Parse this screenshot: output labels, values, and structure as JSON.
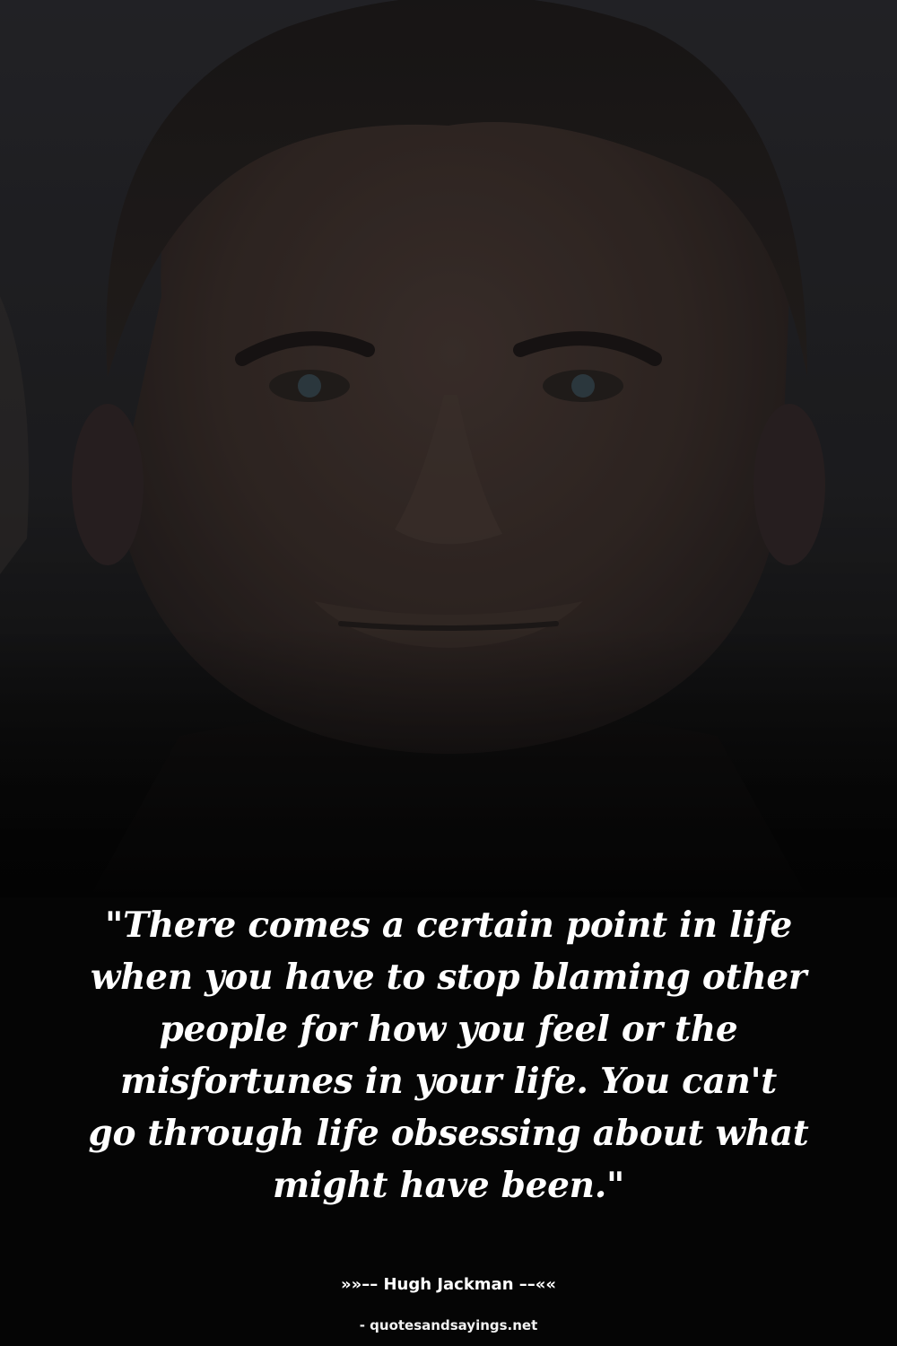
{
  "quote": {
    "lines": [
      "\"There comes a certain point in life",
      "when you have to stop blaming other",
      "people for how you feel or the",
      "misfortunes in your life. You can't",
      "go through life obsessing about what",
      "might have been.\""
    ]
  },
  "author": {
    "label": "»»–– Hugh Jackman ––««"
  },
  "source": {
    "label": "- quotesandsayings.net"
  },
  "colors": {
    "background": "#050505",
    "text": "#ffffff"
  }
}
